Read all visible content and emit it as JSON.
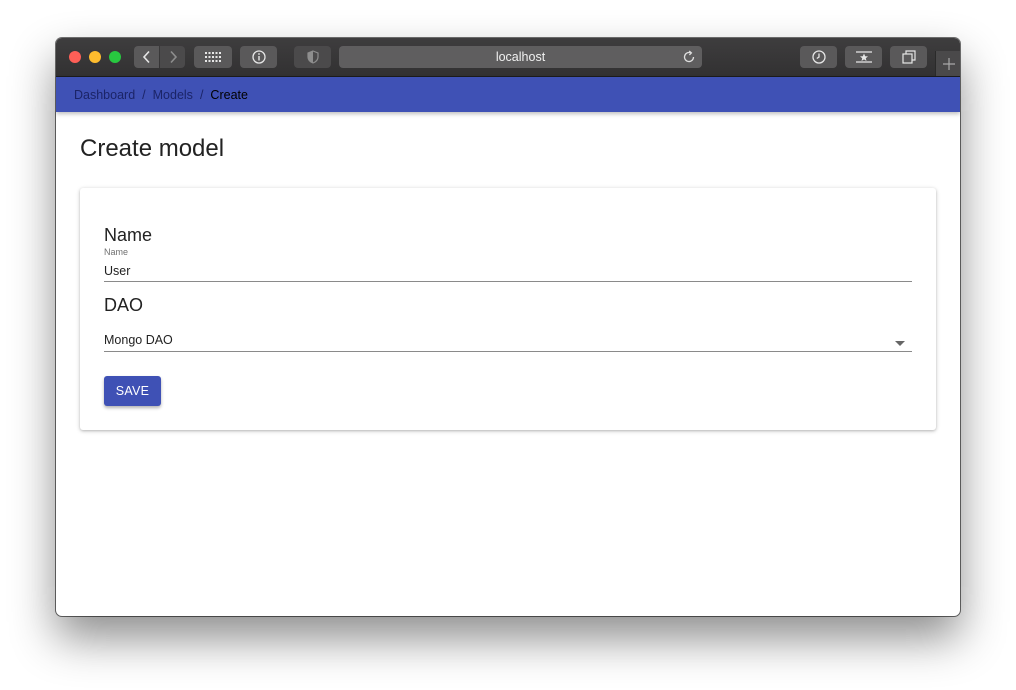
{
  "browser": {
    "url": "localhost"
  },
  "breadcrumb": {
    "items": [
      "Dashboard",
      "Models"
    ],
    "separator": "/",
    "current": "Create"
  },
  "page": {
    "title": "Create model"
  },
  "form": {
    "name_heading": "Name",
    "name_label": "Name",
    "name_value": "User",
    "dao_heading": "DAO",
    "dao_value": "Mongo DAO",
    "save_label": "SAVE"
  },
  "colors": {
    "primary": "#3f51b5",
    "titlebar": "#3a393a"
  }
}
